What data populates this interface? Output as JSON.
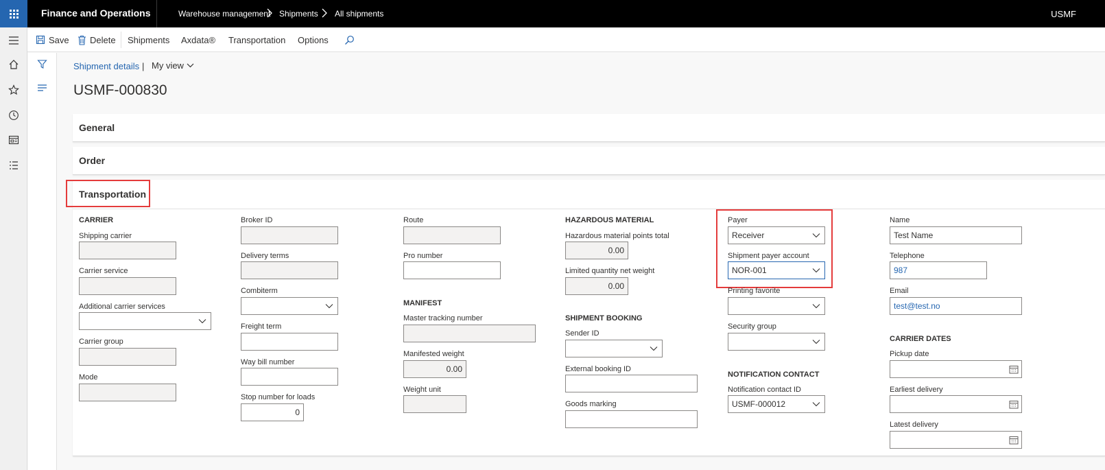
{
  "app": {
    "title": "Finance and Operations",
    "company": "USMF"
  },
  "breadcrumbs": [
    "Warehouse management",
    "Shipments",
    "All shipments"
  ],
  "actions": {
    "save": "Save",
    "delete": "Delete",
    "shipments": "Shipments",
    "axdata": "Axdata®",
    "transportation": "Transportation",
    "options": "Options"
  },
  "view": {
    "link": "Shipment details",
    "separator": "|",
    "my_view": "My view"
  },
  "record": {
    "title": "USMF-000830"
  },
  "fasttabs": {
    "general": "General",
    "order": "Order",
    "transportation": "Transportation"
  },
  "carrier": {
    "group": "CARRIER",
    "shipping_carrier": {
      "label": "Shipping carrier",
      "value": ""
    },
    "carrier_service": {
      "label": "Carrier service",
      "value": ""
    },
    "additional_services": {
      "label": "Additional carrier services",
      "value": ""
    },
    "carrier_group": {
      "label": "Carrier group",
      "value": ""
    },
    "mode": {
      "label": "Mode",
      "value": ""
    }
  },
  "col2": {
    "broker_id": {
      "label": "Broker ID",
      "value": ""
    },
    "delivery_terms": {
      "label": "Delivery terms",
      "value": ""
    },
    "combiterm": {
      "label": "Combiterm",
      "value": ""
    },
    "freight_term": {
      "label": "Freight term",
      "value": ""
    },
    "way_bill": {
      "label": "Way bill number",
      "value": ""
    },
    "stop_number": {
      "label": "Stop number for loads",
      "value": "0"
    }
  },
  "col3": {
    "route": {
      "label": "Route",
      "value": ""
    },
    "pro_number": {
      "label": "Pro number",
      "value": ""
    },
    "manifest_group": "MANIFEST",
    "master_tracking": {
      "label": "Master tracking number",
      "value": ""
    },
    "manifested_weight": {
      "label": "Manifested weight",
      "value": "0.00"
    },
    "weight_unit": {
      "label": "Weight unit",
      "value": ""
    }
  },
  "hazardous": {
    "group": "HAZARDOUS MATERIAL",
    "points_total": {
      "label": "Hazardous material points total",
      "value": "0.00"
    },
    "limited_qty": {
      "label": "Limited quantity net weight",
      "value": "0.00"
    }
  },
  "booking": {
    "group": "SHIPMENT BOOKING",
    "sender_id": {
      "label": "Sender ID",
      "value": ""
    },
    "external_booking": {
      "label": "External booking ID",
      "value": ""
    },
    "goods_marking": {
      "label": "Goods marking",
      "value": ""
    }
  },
  "payer": {
    "payer": {
      "label": "Payer",
      "value": "Receiver"
    },
    "payer_account": {
      "label": "Shipment payer account",
      "value": "NOR-001"
    },
    "printing_favorite": {
      "label": "Printing favorite",
      "value": ""
    },
    "security_group": {
      "label": "Security group",
      "value": ""
    },
    "notification_group": "NOTIFICATION CONTACT",
    "notification_contact": {
      "label": "Notification contact ID",
      "value": "USMF-000012"
    }
  },
  "contact": {
    "name": {
      "label": "Name",
      "value": "Test Name"
    },
    "telephone": {
      "label": "Telephone",
      "value": "987"
    },
    "email": {
      "label": "Email",
      "value": "test@test.no"
    },
    "dates_group": "CARRIER DATES",
    "pickup": {
      "label": "Pickup date",
      "value": ""
    },
    "earliest": {
      "label": "Earliest delivery",
      "value": ""
    },
    "latest": {
      "label": "Latest delivery",
      "value": ""
    }
  },
  "colors": {
    "brand": "#2566b0",
    "highlight": "#e43b3b",
    "topbar": "#000000"
  }
}
